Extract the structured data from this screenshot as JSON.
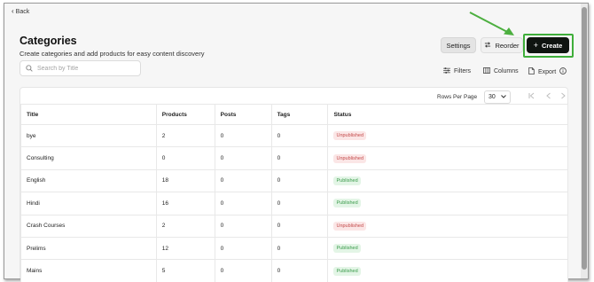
{
  "nav": {
    "back_label": "Back"
  },
  "header": {
    "title": "Categories",
    "subtitle": "Create categories and add products for easy content discovery"
  },
  "search": {
    "placeholder": "Search by Title",
    "value": ""
  },
  "actions": {
    "settings_label": "Settings",
    "reorder_label": "Reorder",
    "create_label": "Create"
  },
  "toolbar": {
    "filters_label": "Filters",
    "columns_label": "Columns",
    "export_label": "Export"
  },
  "pagination": {
    "rows_per_page_label": "Rows Per Page",
    "rows_per_page_value": "30"
  },
  "table": {
    "columns": [
      "Title",
      "Products",
      "Posts",
      "Tags",
      "Status"
    ],
    "rows": [
      {
        "title": "bye",
        "products": "2",
        "posts": "0",
        "tags": "0",
        "status": "Unpublished"
      },
      {
        "title": "Consulting",
        "products": "0",
        "posts": "0",
        "tags": "0",
        "status": "Unpublished"
      },
      {
        "title": "English",
        "products": "18",
        "posts": "0",
        "tags": "0",
        "status": "Published"
      },
      {
        "title": "Hindi",
        "products": "16",
        "posts": "0",
        "tags": "0",
        "status": "Published"
      },
      {
        "title": "Crash Courses",
        "products": "2",
        "posts": "0",
        "tags": "0",
        "status": "Unpublished"
      },
      {
        "title": "Prelims",
        "products": "12",
        "posts": "0",
        "tags": "0",
        "status": "Published"
      },
      {
        "title": "Mains",
        "products": "5",
        "posts": "0",
        "tags": "0",
        "status": "Published"
      }
    ]
  },
  "colors": {
    "create_bg": "#0f1410",
    "highlight": "#3fae3a",
    "published_text": "#3a9a4a",
    "unpublished_text": "#c44b4b"
  },
  "icons": [
    "chevron-left-icon",
    "search-icon",
    "plus-icon",
    "reorder-icon",
    "filters-icon",
    "columns-icon",
    "export-icon",
    "info-icon",
    "chevron-down-icon",
    "first-page-icon",
    "prev-page-icon",
    "next-page-icon"
  ]
}
